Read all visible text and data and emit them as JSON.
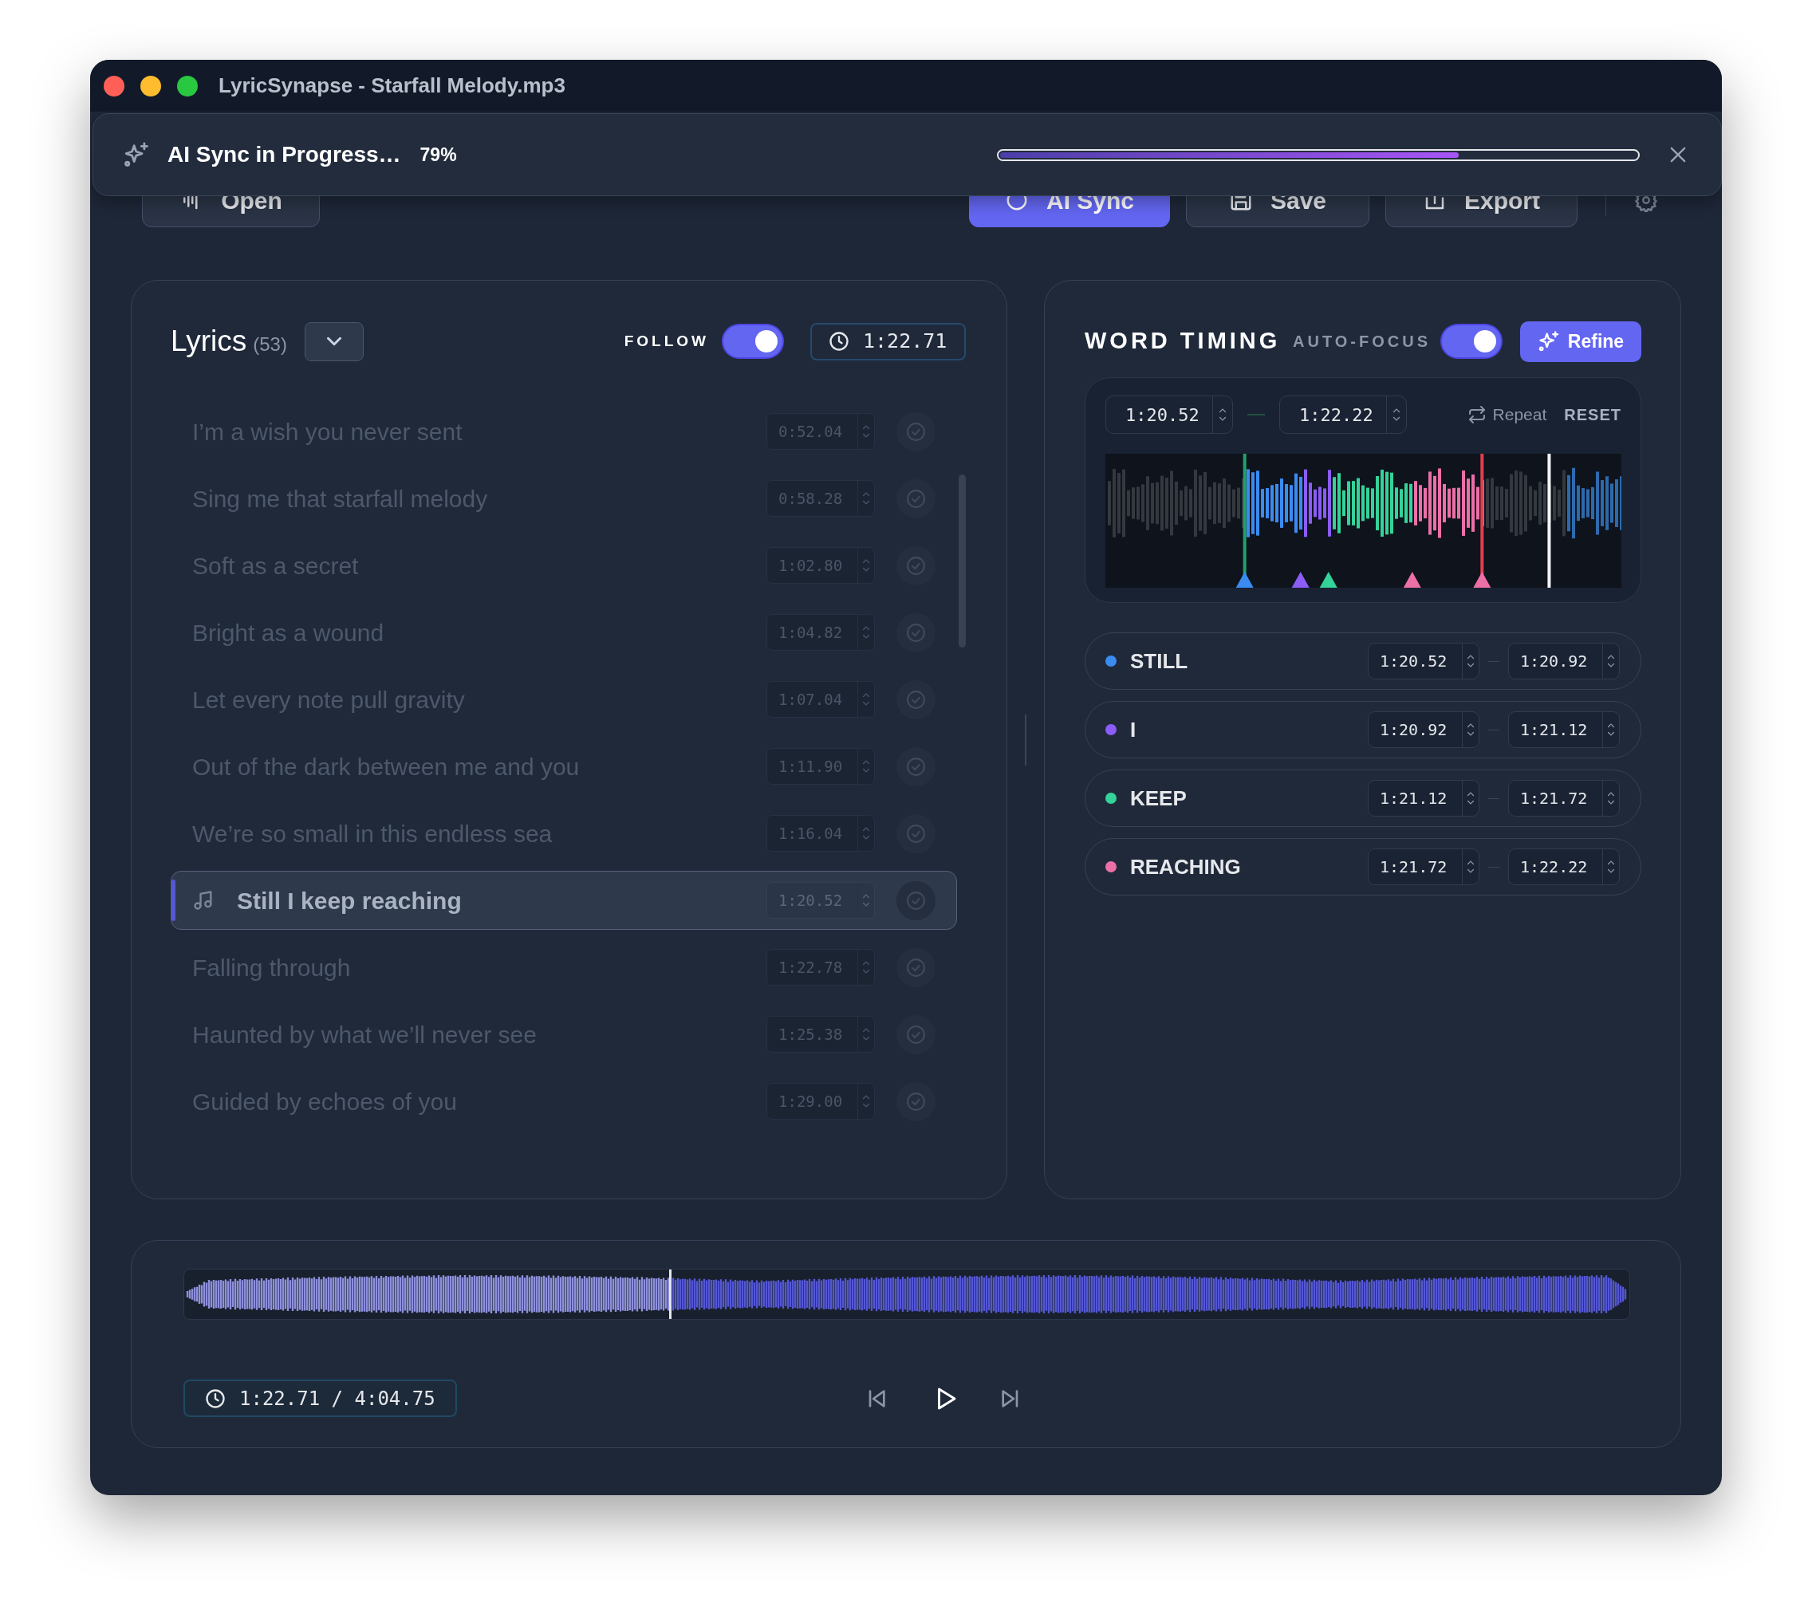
{
  "window": {
    "title": "LyricSynapse - Starfall Melody.mp3"
  },
  "notification": {
    "title": "AI Sync in Progress…",
    "percent": "79%",
    "level": 0.72
  },
  "toolbar": {
    "buttons": [
      {
        "label": "Open",
        "kind": "open"
      },
      {
        "label": "AI Sync",
        "kind": "sync"
      },
      {
        "label": "Save",
        "kind": "save"
      },
      {
        "label": "Export",
        "kind": "export"
      }
    ]
  },
  "lyrics": {
    "title": "Lyrics",
    "count": "(53)",
    "follow_label": "FOLLOW",
    "follow_on": true,
    "time": "1:22.71",
    "lines": [
      {
        "text": "I’m a wish you never sent",
        "time": "0:52.04",
        "selected": false
      },
      {
        "text": "Sing me that starfall melody",
        "time": "0:58.28",
        "selected": false
      },
      {
        "text": "Soft as a secret",
        "time": "1:02.80",
        "selected": false
      },
      {
        "text": "Bright as a wound",
        "time": "1:04.82",
        "selected": false
      },
      {
        "text": "Let every note pull gravity",
        "time": "1:07.04",
        "selected": false
      },
      {
        "text": "Out of the dark between me and you",
        "time": "1:11.90",
        "selected": false
      },
      {
        "text": "We’re so small in this endless sea",
        "time": "1:16.04",
        "selected": false
      },
      {
        "text": "Still I keep reaching",
        "time": "1:20.52",
        "selected": true
      },
      {
        "text": "Falling through",
        "time": "1:22.78",
        "selected": false
      },
      {
        "text": "Haunted by what we’ll never see",
        "time": "1:25.38",
        "selected": false
      },
      {
        "text": "Guided by echoes of you",
        "time": "1:29.00",
        "selected": false
      }
    ]
  },
  "word_timing": {
    "title": "WORD TIMING",
    "auto_focus_label": "AUTO-FOCUS",
    "auto_focus_on": true,
    "refine": "Refine",
    "range_start": "1:20.52",
    "range_end": "1:22.22",
    "repeat": "Repeat",
    "reset": "RESET",
    "words": [
      {
        "word": "STILL",
        "color": "#3b8bf0",
        "start": "1:20.52",
        "end": "1:20.92"
      },
      {
        "word": "I",
        "color": "#8b5cf6",
        "start": "1:20.92",
        "end": "1:21.12"
      },
      {
        "word": "KEEP",
        "color": "#34d399",
        "start": "1:21.12",
        "end": "1:21.72"
      },
      {
        "word": "REACHING",
        "color": "#ec6fa8",
        "start": "1:21.72",
        "end": "1:22.22"
      }
    ]
  },
  "player": {
    "time": "1:22.71 / 4:04.75",
    "level": 0.337
  }
}
